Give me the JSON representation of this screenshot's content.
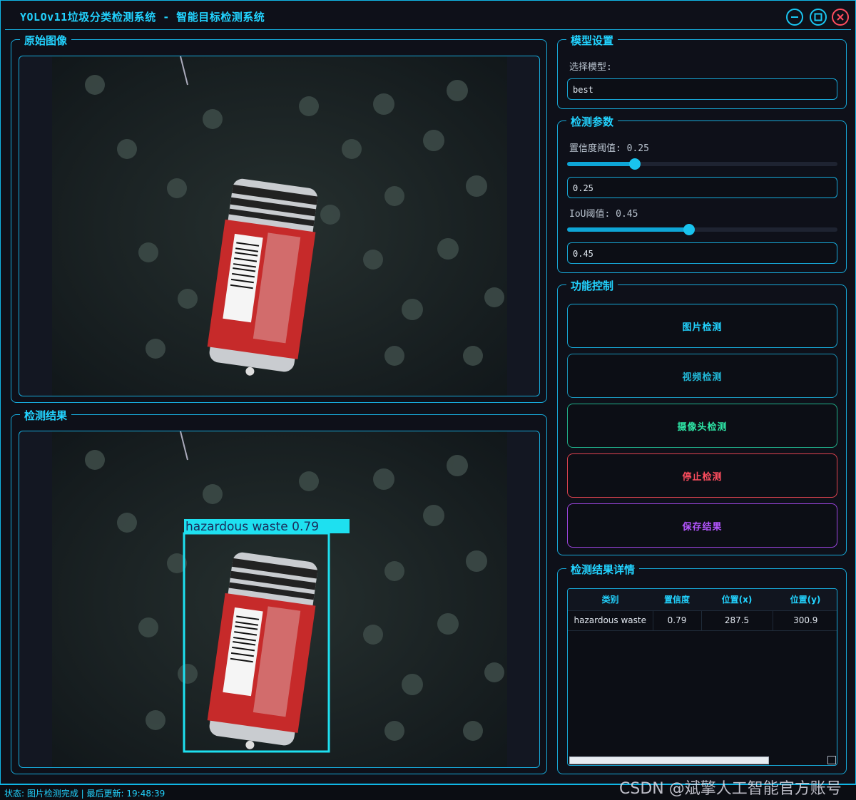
{
  "window": {
    "title": "YOLOv11垃圾分类检测系统 - 智能目标检测系统"
  },
  "panels": {
    "original": {
      "title": "原始图像"
    },
    "result": {
      "title": "检测结果"
    }
  },
  "detection_box": {
    "label": "hazardous waste 0.79"
  },
  "model_settings": {
    "title": "模型设置",
    "select_label": "选择模型:",
    "model_value": "best"
  },
  "params": {
    "title": "检测参数",
    "conf_label": "置信度阈值: 0.25",
    "conf_value": "0.25",
    "conf_level": 0.25,
    "iou_label": "IoU阈值: 0.45",
    "iou_value": "0.45",
    "iou_level": 0.45
  },
  "controls": {
    "title": "功能控制",
    "image_detect": "图片检测",
    "video_detect": "视频检测",
    "camera_detect": "摄像头检测",
    "stop_detect": "停止检测",
    "save_result": "保存结果"
  },
  "details": {
    "title": "检测结果详情",
    "columns": [
      "类别",
      "置信度",
      "位置(x)",
      "位置(y)"
    ],
    "rows": [
      [
        "hazardous waste",
        "0.79",
        "287.5",
        "300.9"
      ]
    ]
  },
  "status": {
    "text": "状态: 图片检测完成 | 最后更新: 19:48:39"
  },
  "watermark": "CSDN @斌擎人工智能官方账号",
  "colors": {
    "accent": "#22d3ff",
    "video_btn": "#22b8d8",
    "camera_btn": "#2ee6a6",
    "stop_btn": "#ff4d5e",
    "save_btn": "#b455ff"
  }
}
